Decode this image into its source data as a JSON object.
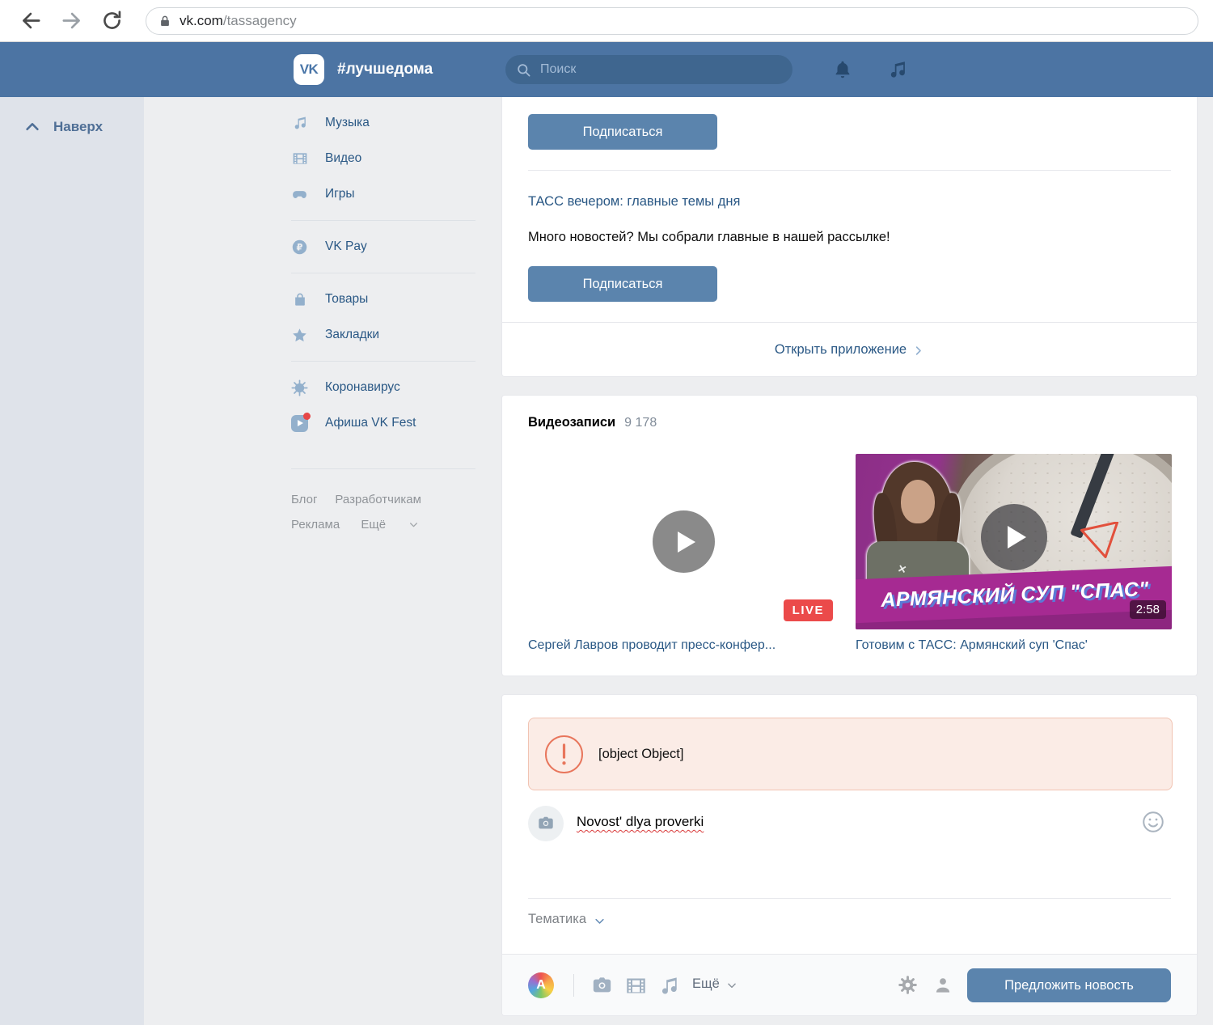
{
  "browser": {
    "url_host": "vk.com",
    "url_path": "/tassagency"
  },
  "header": {
    "logo": "VK",
    "hashtag": "#лучшедома",
    "search_placeholder": "Поиск"
  },
  "back_to_top": {
    "label": "Наверх"
  },
  "sidebar": {
    "items": [
      {
        "label": "Музыка"
      },
      {
        "label": "Видео"
      },
      {
        "label": "Игры"
      },
      {
        "label": "VK Pay"
      },
      {
        "label": "Товары"
      },
      {
        "label": "Закладки"
      },
      {
        "label": "Коронавирус"
      },
      {
        "label": "Афиша VK Fest"
      }
    ],
    "footer_links": [
      {
        "label": "Блог"
      },
      {
        "label": "Разработчикам"
      },
      {
        "label": "Реклама"
      },
      {
        "label": "Ещё"
      }
    ]
  },
  "subscribe_card": {
    "subscribe_top": "Подписаться",
    "digest_title": "ТАСС вечером: главные темы дня",
    "digest_text": "Много новостей? Мы собрали главные в нашей рассылке!",
    "subscribe_bottom": "Подписаться",
    "open_app": "Открыть приложение"
  },
  "videos_card": {
    "title": "Видеозаписи",
    "count": "9 178",
    "videos": [
      {
        "title": "Сергей Лавров проводит пресс-конфер...",
        "badge": "LIVE"
      },
      {
        "title": "Готовим с ТАСС: Армянский суп 'Спас'",
        "duration": "2:58",
        "thumb_text": "АРМЯНСКИЙ СУП \"СПАС\"",
        "thumb_mark": "✕"
      }
    ]
  },
  "composer_card": {
    "error_text": "[object Object]",
    "post_text": "Novost' dlya proverki",
    "topic_label": "Тематика",
    "attach_more": "Ещё",
    "a_badge": "A",
    "submit": "Предложить новость"
  },
  "colors": {
    "header_blue": "#4c74a3",
    "accent_blue": "#5b84ad",
    "link_blue": "#2a5885",
    "live_red": "#eb4a4a",
    "banner_magenta": "#a62a92"
  }
}
